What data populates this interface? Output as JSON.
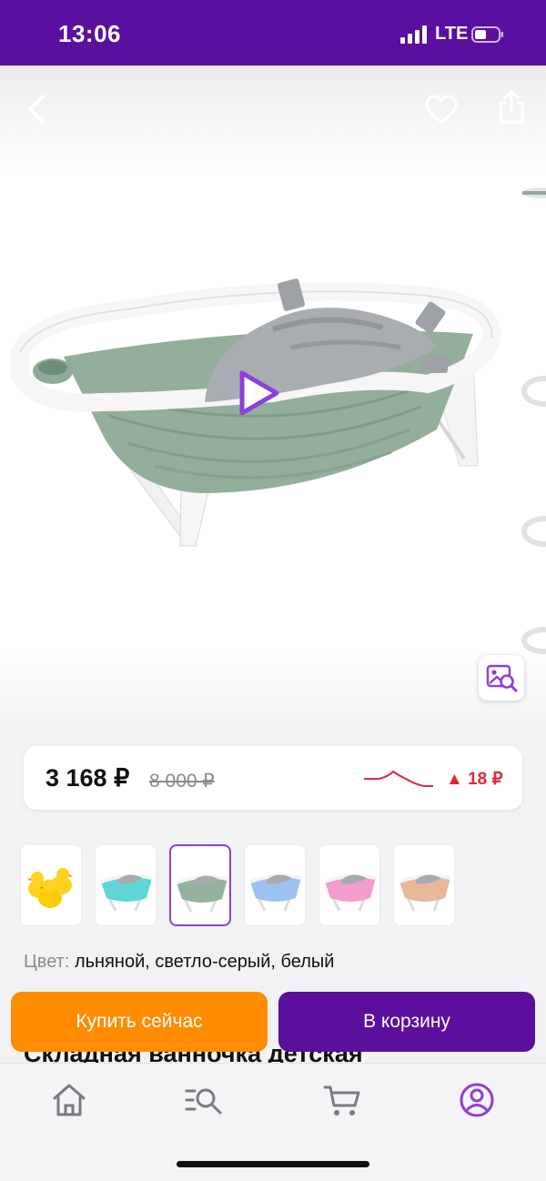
{
  "status_bar": {
    "time": "13:06",
    "network": "LTE",
    "icons": [
      "signal-bars-icon",
      "battery-icon"
    ]
  },
  "gallery": {
    "back_icon": "chevron-left-icon",
    "favorite_icon": "heart-icon",
    "share_icon": "share-icon",
    "play_icon": "play-icon",
    "visual_search_icon": "image-search-icon",
    "image": "folding-baby-bathtub-sage-green"
  },
  "price": {
    "current": "3 168 ₽",
    "old": "8 000 ₽",
    "delta": "▲ 18 ₽",
    "delta_color": "#e3263b"
  },
  "variants": [
    {
      "name": "ducks",
      "color": "#ffd21f"
    },
    {
      "name": "turquoise",
      "color": "#5fd6d6"
    },
    {
      "name": "sage-green",
      "color": "#93b39f",
      "selected": true
    },
    {
      "name": "light-blue",
      "color": "#9cc3ef"
    },
    {
      "name": "pink",
      "color": "#f39ccd"
    },
    {
      "name": "beige",
      "color": "#e8b89a"
    }
  ],
  "color_info": {
    "label": "Цвет:",
    "value": "льняной, светло-серый, белый"
  },
  "product_title_peek": "Складная ванночка детская",
  "actions": {
    "buy_now": "Купить сейчас",
    "add_to_cart": "В корзину"
  },
  "bottom_nav": {
    "items": [
      "home-icon",
      "catalog-search-icon",
      "cart-icon",
      "profile-icon"
    ],
    "active": "profile-icon",
    "accent": "#8e3fd6"
  },
  "colors": {
    "brand": "#5a0f9e",
    "buy_button": "#ff8c00",
    "cart_button": "#5b0f9c"
  }
}
